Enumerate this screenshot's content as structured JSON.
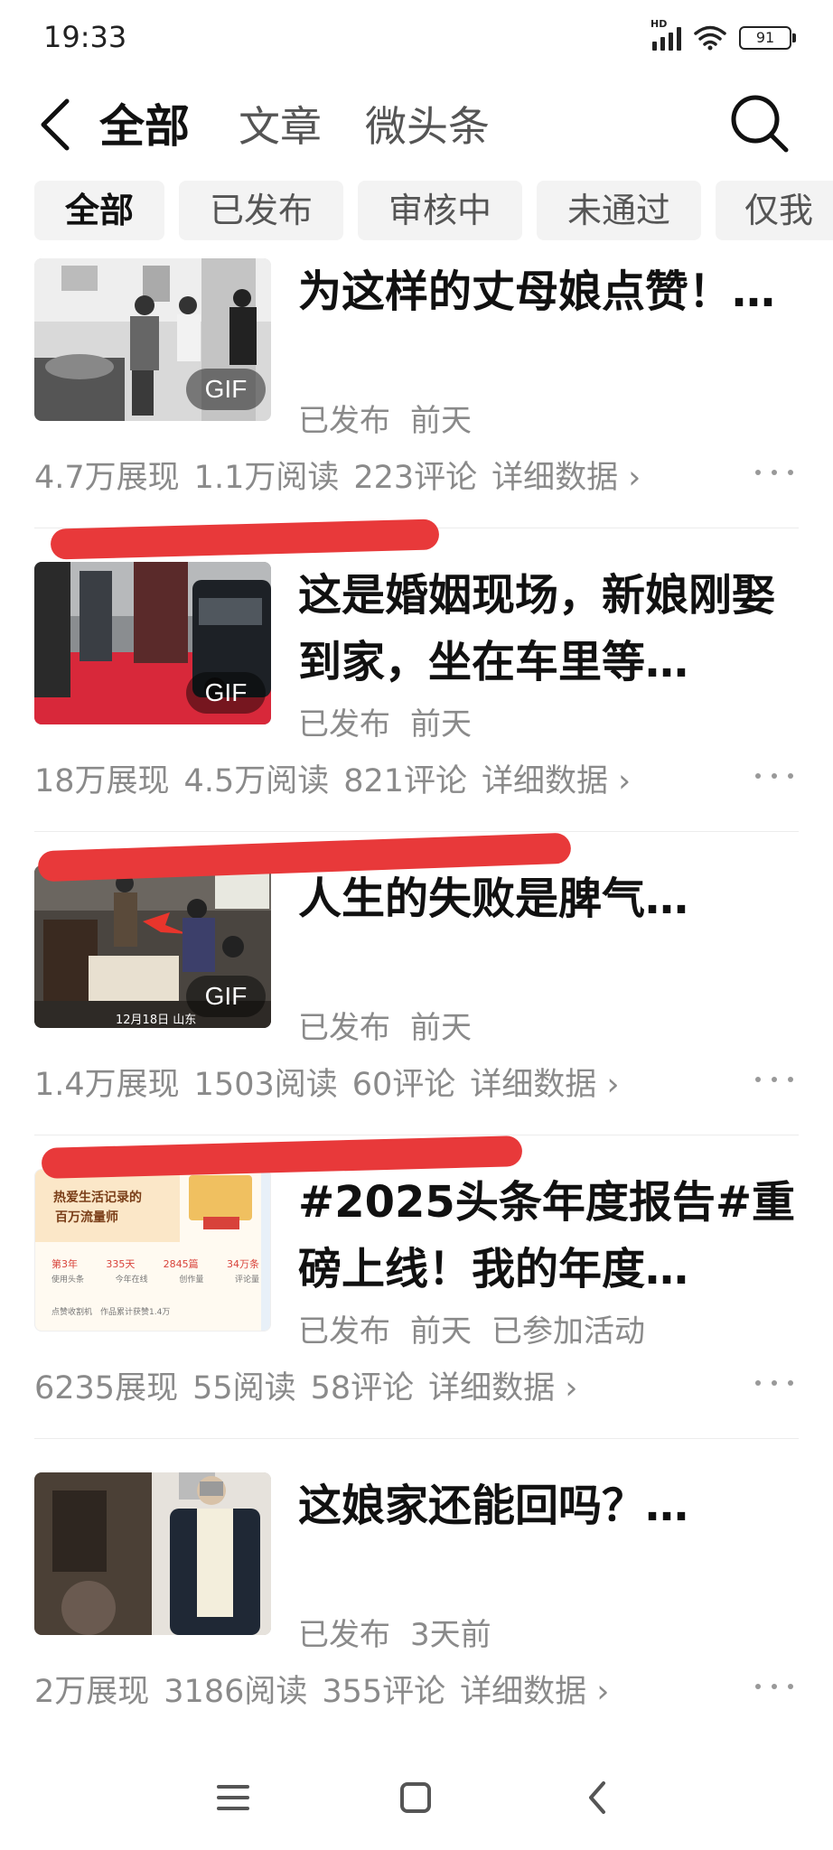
{
  "status_bar": {
    "time": "19:33",
    "network": "HD",
    "battery": "91"
  },
  "nav": {
    "tabs": [
      "全部",
      "文章",
      "微头条"
    ],
    "active": 0
  },
  "filters": [
    "全部",
    "已发布",
    "审核中",
    "未通过",
    "仅我"
  ],
  "items": [
    {
      "title": "为这样的丈母娘点赞！…",
      "status": "已发布",
      "time": "前天",
      "extra": "",
      "gif": "GIF",
      "stats": {
        "views": "4.7万展现",
        "reads": "1.1万阅读",
        "comments": "223评论"
      }
    },
    {
      "title": "这是婚姻现场，新娘刚娶到家，坐在车里等…",
      "status": "已发布",
      "time": "前天",
      "extra": "",
      "gif": "GIF",
      "stats": {
        "views": "18万展现",
        "reads": "4.5万阅读",
        "comments": "821评论"
      }
    },
    {
      "title": "人生的失败是脾气…",
      "status": "已发布",
      "time": "前天",
      "extra": "",
      "gif": "GIF",
      "stats": {
        "views": "1.4万展现",
        "reads": "1503阅读",
        "comments": "60评论"
      }
    },
    {
      "title": "#2025头条年度报告#重磅上线！我的年度…",
      "status": "已发布",
      "time": "前天",
      "extra": "已参加活动",
      "gif": "",
      "stats": {
        "views": "6235展现",
        "reads": "55阅读",
        "comments": "58评论"
      }
    },
    {
      "title": "这娘家还能回吗？…",
      "status": "已发布",
      "time": "3天前",
      "extra": "",
      "gif": "",
      "stats": {
        "views": "2万展现",
        "reads": "3186阅读",
        "comments": "355评论"
      }
    }
  ],
  "detail_label": "详细数据",
  "thumb4": {
    "headline": "热爱生活记录的",
    "subline": "百万流量师",
    "stats_values": [
      "第3年",
      "335天",
      "2845篇",
      "34万条"
    ],
    "stats_labels": [
      "使用头条",
      "今年在线",
      "创作量",
      "评论量"
    ],
    "footer": "点赞收割机　作品累计获赞1.4万"
  },
  "thumb3_caption": "12月18日 山东",
  "colors": {
    "accent_red": "#e8393a",
    "text_primary": "#111111",
    "text_secondary": "#8a8a8a"
  }
}
